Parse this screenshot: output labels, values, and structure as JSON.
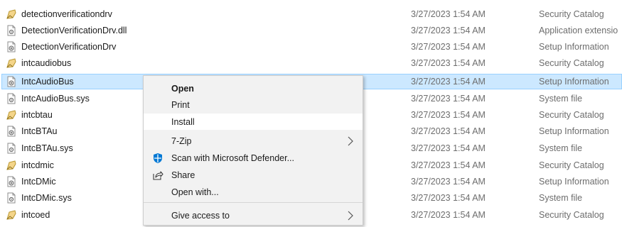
{
  "files": [
    {
      "name": "detectionverificationdrv",
      "date": "3/27/2023 1:54 AM",
      "type": "Security Catalog",
      "icon": "catalog-icon"
    },
    {
      "name": "DetectionVerificationDrv.dll",
      "date": "3/27/2023 1:54 AM",
      "type": "Application extensio",
      "icon": "dll-icon"
    },
    {
      "name": "DetectionVerificationDrv",
      "date": "3/27/2023 1:54 AM",
      "type": "Setup Information",
      "icon": "setup-info-icon"
    },
    {
      "name": "intcaudiobus",
      "date": "3/27/2023 1:54 AM",
      "type": "Security Catalog",
      "icon": "catalog-icon"
    },
    {
      "name": "IntcAudioBus",
      "date": "3/27/2023 1:54 AM",
      "type": "Setup Information",
      "icon": "setup-info-icon",
      "selected": true
    },
    {
      "name": "IntcAudioBus.sys",
      "date": "3/27/2023 1:54 AM",
      "type": "System file",
      "icon": "system-file-icon"
    },
    {
      "name": "intcbtau",
      "date": "3/27/2023 1:54 AM",
      "type": "Security Catalog",
      "icon": "catalog-icon"
    },
    {
      "name": "IntcBTAu",
      "date": "3/27/2023 1:54 AM",
      "type": "Setup Information",
      "icon": "setup-info-icon"
    },
    {
      "name": "IntcBTAu.sys",
      "date": "3/27/2023 1:54 AM",
      "type": "System file",
      "icon": "system-file-icon"
    },
    {
      "name": "intcdmic",
      "date": "3/27/2023 1:54 AM",
      "type": "Security Catalog",
      "icon": "catalog-icon"
    },
    {
      "name": "IntcDMic",
      "date": "3/27/2023 1:54 AM",
      "type": "Setup Information",
      "icon": "setup-info-icon"
    },
    {
      "name": "IntcDMic.sys",
      "date": "3/27/2023 1:54 AM",
      "type": "System file",
      "icon": "system-file-icon"
    },
    {
      "name": "intcoed",
      "date": "3/27/2023 1:54 AM",
      "type": "Security Catalog",
      "icon": "catalog-icon"
    }
  ],
  "context_menu": {
    "items": [
      {
        "label": "Open",
        "bold": true
      },
      {
        "label": "Print"
      },
      {
        "label": "Install",
        "highlighted": true
      },
      {
        "label": "7-Zip",
        "submenu": true
      },
      {
        "label": "Scan with Microsoft Defender...",
        "icon": "defender-shield-icon"
      },
      {
        "label": "Share",
        "icon": "share-icon"
      },
      {
        "label": "Open with..."
      },
      {
        "label": "Give access to",
        "submenu": true
      }
    ]
  },
  "colors": {
    "selection_fill": "#cce8ff",
    "selection_border": "#99d1ff",
    "menu_background": "#f2f2f2",
    "menu_highlight": "#ffffff",
    "secondary_text": "#6d6d6d",
    "defender_blue": "#0078d4"
  }
}
